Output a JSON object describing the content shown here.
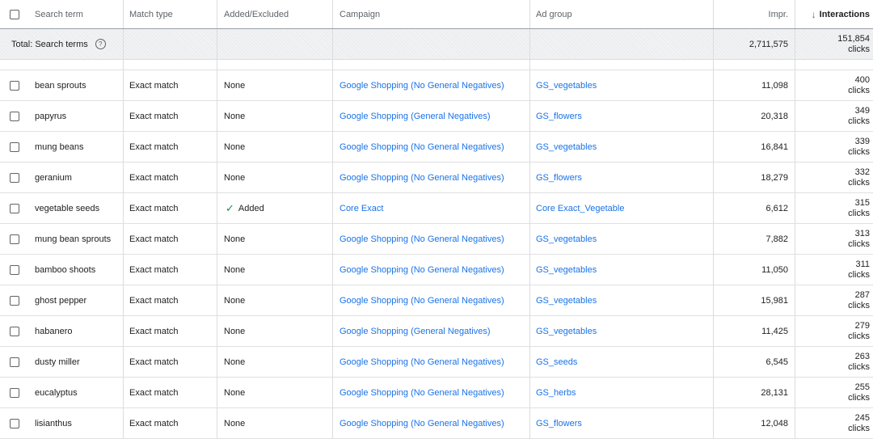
{
  "header": {
    "search_term": "Search term",
    "match_type": "Match type",
    "added_excluded": "Added/Excluded",
    "campaign": "Campaign",
    "ad_group": "Ad group",
    "impr": "Impr.",
    "interactions": "Interactions",
    "sort_icon": "arrow-down-icon"
  },
  "total": {
    "label": "Total: Search terms",
    "help_icon": "help-circle-icon",
    "impr": "2,711,575",
    "interactions_value": "151,854",
    "interactions_unit": "clicks"
  },
  "rows": [
    {
      "term": "bean sprouts",
      "match": "Exact match",
      "status": "None",
      "campaign": "Google Shopping (No General Negatives)",
      "ad_group": "GS_vegetables",
      "impr": "11,098",
      "interactions": "400",
      "unit": "clicks"
    },
    {
      "term": "papyrus",
      "match": "Exact match",
      "status": "None",
      "campaign": "Google Shopping (General Negatives)",
      "ad_group": "GS_flowers",
      "impr": "20,318",
      "interactions": "349",
      "unit": "clicks"
    },
    {
      "term": "mung beans",
      "match": "Exact match",
      "status": "None",
      "campaign": "Google Shopping (No General Negatives)",
      "ad_group": "GS_vegetables",
      "impr": "16,841",
      "interactions": "339",
      "unit": "clicks"
    },
    {
      "term": "geranium",
      "match": "Exact match",
      "status": "None",
      "campaign": "Google Shopping (No General Negatives)",
      "ad_group": "GS_flowers",
      "impr": "18,279",
      "interactions": "332",
      "unit": "clicks"
    },
    {
      "term": "vegetable seeds",
      "match": "Exact match",
      "status": "Added",
      "campaign": "Core Exact",
      "ad_group": "Core Exact_Vegetable",
      "impr": "6,612",
      "interactions": "315",
      "unit": "clicks"
    },
    {
      "term": "mung bean sprouts",
      "match": "Exact match",
      "status": "None",
      "campaign": "Google Shopping (No General Negatives)",
      "ad_group": "GS_vegetables",
      "impr": "7,882",
      "interactions": "313",
      "unit": "clicks"
    },
    {
      "term": "bamboo shoots",
      "match": "Exact match",
      "status": "None",
      "campaign": "Google Shopping (No General Negatives)",
      "ad_group": "GS_vegetables",
      "impr": "11,050",
      "interactions": "311",
      "unit": "clicks"
    },
    {
      "term": "ghost pepper",
      "match": "Exact match",
      "status": "None",
      "campaign": "Google Shopping (No General Negatives)",
      "ad_group": "GS_vegetables",
      "impr": "15,981",
      "interactions": "287",
      "unit": "clicks"
    },
    {
      "term": "habanero",
      "match": "Exact match",
      "status": "None",
      "campaign": "Google Shopping (General Negatives)",
      "ad_group": "GS_vegetables",
      "impr": "11,425",
      "interactions": "279",
      "unit": "clicks"
    },
    {
      "term": "dusty miller",
      "match": "Exact match",
      "status": "None",
      "campaign": "Google Shopping (No General Negatives)",
      "ad_group": "GS_seeds",
      "impr": "6,545",
      "interactions": "263",
      "unit": "clicks"
    },
    {
      "term": "eucalyptus",
      "match": "Exact match",
      "status": "None",
      "campaign": "Google Shopping (No General Negatives)",
      "ad_group": "GS_herbs",
      "impr": "28,131",
      "interactions": "255",
      "unit": "clicks"
    },
    {
      "term": "lisianthus",
      "match": "Exact match",
      "status": "None",
      "campaign": "Google Shopping (No General Negatives)",
      "ad_group": "GS_flowers",
      "impr": "12,048",
      "interactions": "245",
      "unit": "clicks"
    }
  ]
}
